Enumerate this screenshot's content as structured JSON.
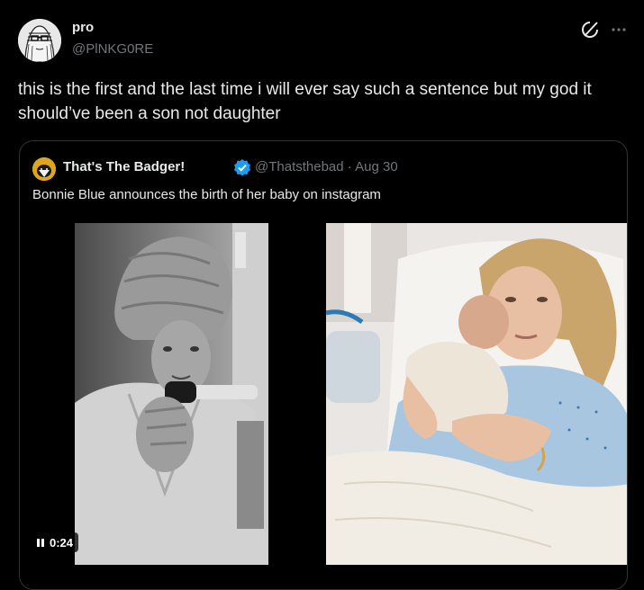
{
  "author": {
    "display_name": "pro",
    "handle": "@PlNKG0RE"
  },
  "tweet": {
    "text": "this is the first and the last time i will ever say such a sentence but my god it should’ve been a son not daughter"
  },
  "quote": {
    "display_name": "That's The Badger!",
    "handle_and_date": "@Thatsthebad · Aug 30",
    "text": "Bonnie Blue announces the birth of her baby on instagram",
    "verified_color": "#1d9bf0",
    "media": {
      "left_image": "woman-in-towel-holding-pregnancy-test",
      "right_image": "woman-in-hospital-bed-holding-newborn"
    },
    "video": {
      "state": "playing",
      "time": "0:24"
    }
  },
  "icons": {
    "grok": "grok-icon",
    "more": "more-icon",
    "verified": "verified-icon",
    "pause": "pause-icon"
  },
  "colors": {
    "background": "#000000",
    "text_primary": "#e7e9ea",
    "text_secondary": "#71767b",
    "border": "#2f3336",
    "accent": "#1d9bf0"
  }
}
